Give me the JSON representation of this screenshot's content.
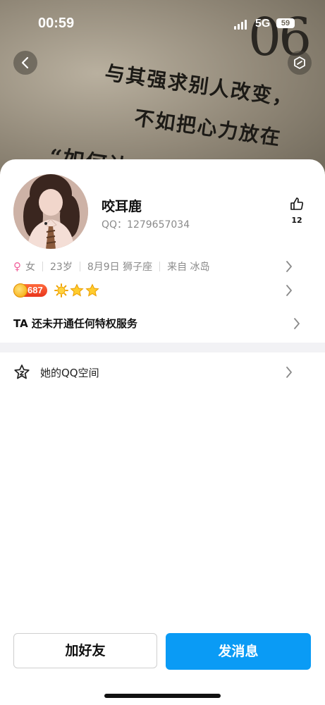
{
  "status_bar": {
    "time": "00:59",
    "network": "5G",
    "battery": "59"
  },
  "cover": {
    "line1": "与其强求别人改变，",
    "line2": "不如把心力放在",
    "line3": "“如何让",
    "number": "06"
  },
  "profile": {
    "name": "咬耳鹿",
    "qq": "QQ：1279657034",
    "likes": "12",
    "gender_symbol": "♀",
    "gender": "女",
    "age": "23岁",
    "birthday": "8月9日 狮子座",
    "location": "来自 冰岛",
    "level": "687",
    "privilege_text": "TA 还未开通任何特权服务",
    "qzone_label": "她的QQ空间"
  },
  "buttons": {
    "add_friend": "加好友",
    "send_message": "发消息"
  },
  "colors": {
    "accent": "#0a9bf5",
    "female": "#f2609c",
    "level_badge": "#e8341c"
  },
  "icons": {
    "back": "chevron-left-icon",
    "share": "hexagon-share-icon",
    "like": "thumbs-up-icon",
    "qzone": "star-outline-icon"
  }
}
